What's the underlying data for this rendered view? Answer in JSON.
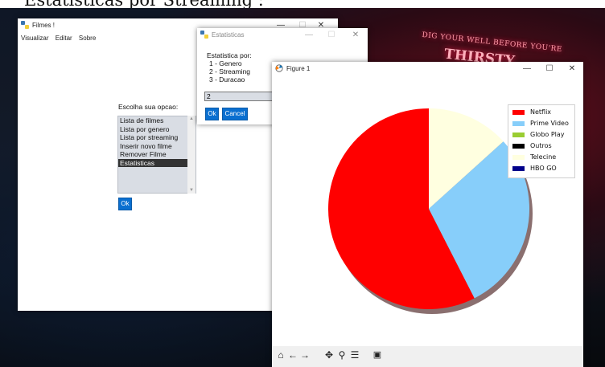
{
  "page_caption": "Estatisticas por Streaming :",
  "desktop": {
    "neon_line1": "DIG YOUR WELL BEFORE YOU'RE",
    "neon_line2": "THIRSTY"
  },
  "filmes_window": {
    "title": "Filmes !",
    "menu": [
      "Visualizar",
      "Editar",
      "Sobre"
    ],
    "prompt": "Escolha sua opcao:",
    "options": [
      "Lista de filmes",
      "Lista por genero",
      "Lista por streaming",
      "Inserir novo filme",
      "Remover Filme",
      "Estatisticas"
    ],
    "selected_index": 5,
    "ok_label": "Ok"
  },
  "stats_dialog": {
    "title": "Estatisticas",
    "label_lines": [
      "Estatistica por:",
      "1 - Genero",
      "2 - Streaming",
      "3 - Duracao"
    ],
    "input_value": "2",
    "ok_label": "Ok",
    "cancel_label": "Cancel"
  },
  "figure_window": {
    "title": "Figure 1",
    "toolbar_icons": [
      "home-icon",
      "back-arrow-icon",
      "forward-arrow-icon",
      "pan-icon",
      "zoom-icon",
      "configure-subplots-icon",
      "save-icon"
    ]
  },
  "window_controls": {
    "minimize": "—",
    "maximize": "☐",
    "close": "✕"
  },
  "chart_data": {
    "type": "pie",
    "title": "",
    "categories": [
      "Netflix",
      "Prime Video",
      "Globo Play",
      "Outros",
      "Telecine",
      "HBO GO"
    ],
    "values": [
      57.5,
      29.2,
      0,
      0,
      13.3,
      0
    ],
    "colors": [
      "#ff0000",
      "#87cefa",
      "#9acd32",
      "#000000",
      "#ffffe0",
      "#00008b"
    ],
    "shadow": true,
    "start_angle_deg": 90,
    "direction": "counterclockwise",
    "legend_placement": "upper-right"
  }
}
